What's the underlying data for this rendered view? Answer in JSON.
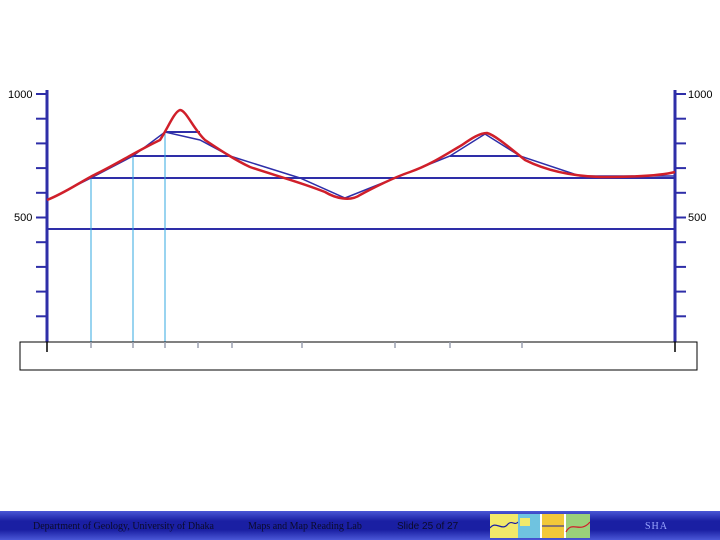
{
  "axis": {
    "left_top_label": "1000",
    "left_mid_label": "500",
    "right_top_label": "1000",
    "right_mid_label": "500"
  },
  "footer": {
    "department": "Department of Geology, University of Dhaka",
    "lab": "Maps and Map Reading Lab",
    "slide": "Slide 25 of 27",
    "initials": "SHA"
  },
  "colors": {
    "axis": "#2e2ea8",
    "profile": "#d01f2a",
    "contour_line": "#2e2ea8",
    "projection": "#33a8e0",
    "footer": "#1a1fa3"
  },
  "thumbnail_icon": "slide-thumbnail-icon"
}
